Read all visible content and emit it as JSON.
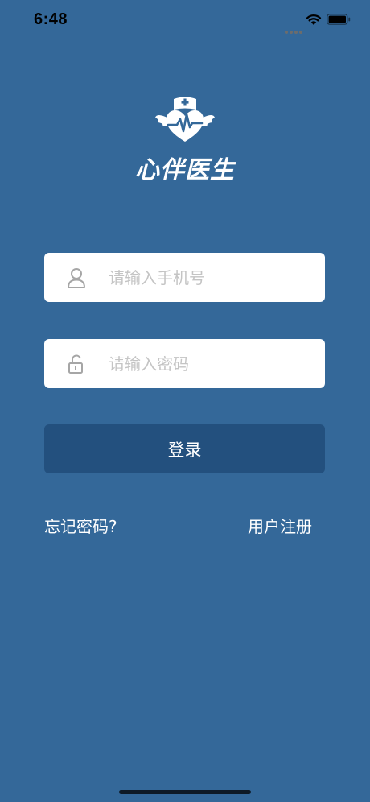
{
  "status_bar": {
    "time": "6:48"
  },
  "app": {
    "name": "心伴医生"
  },
  "form": {
    "phone_placeholder": "请输入手机号",
    "password_placeholder": "请输入密码",
    "login_label": "登录",
    "forgot_label": "忘记密码?",
    "register_label": "用户注册"
  },
  "colors": {
    "background": "#346899",
    "button": "#23507e",
    "input": "#ffffff",
    "placeholder": "#c4c4c4"
  },
  "icons": {
    "phone_field": "user-icon",
    "password_field": "lock-icon",
    "logo": "nurse-heart-logo-icon"
  }
}
